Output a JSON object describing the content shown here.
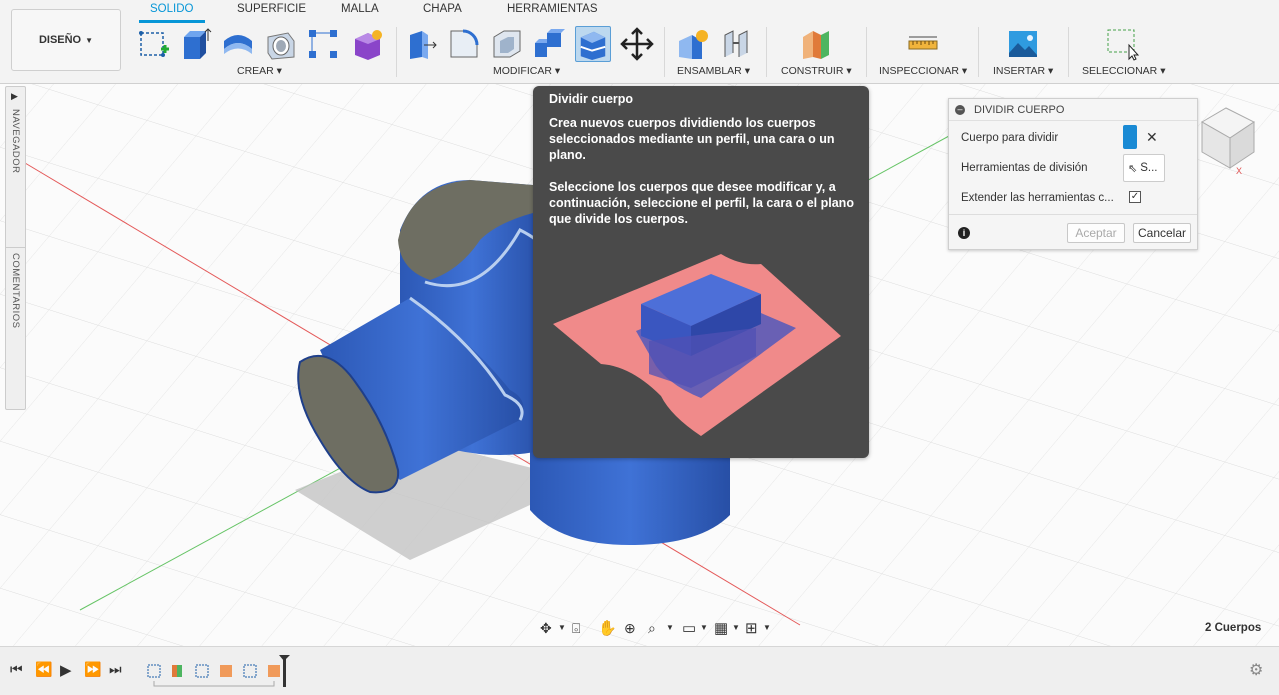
{
  "workspace": {
    "label": "DISEÑO"
  },
  "tabs": [
    {
      "label": "SOLIDO",
      "active": true
    },
    {
      "label": "SUPERFICIE",
      "active": false
    },
    {
      "label": "MALLA",
      "active": false
    },
    {
      "label": "CHAPA",
      "active": false
    },
    {
      "label": "HERRAMIENTAS",
      "active": false
    }
  ],
  "groups": {
    "crear": "CREAR",
    "modificar": "MODIFICAR",
    "ensamblar": "ENSAMBLAR",
    "construir": "CONSTRUIR",
    "inspeccionar": "INSPECCIONAR",
    "insertar": "INSERTAR",
    "seleccionar": "SELECCIONAR"
  },
  "left_panel": {
    "navigator": "NAVEGADOR",
    "comments": "COMENTARIOS"
  },
  "tooltip": {
    "title": "Dividir cuerpo",
    "p1": "Crea nuevos cuerpos dividiendo los cuerpos seleccionados mediante un perfil, una cara o un plano.",
    "p2": "Seleccione los cuerpos que desee modificar y, a continuación, seleccione el perfil, la cara o el plano que divide los cuerpos."
  },
  "dialog": {
    "title": "DIVIDIR CUERPO",
    "body_label": "Cuerpo para dividir",
    "tools_label": "Herramientas de división",
    "tools_value": "S...",
    "extend_label": "Extender las herramientas c...",
    "extend_checked": true,
    "accept": "Aceptar",
    "cancel": "Cancelar"
  },
  "status": {
    "bodies": "2 Cuerpos"
  },
  "colors": {
    "accent": "#0696d7",
    "body_blue": "#2f5fbf",
    "tooltip_bg": "#4a4a4a"
  }
}
